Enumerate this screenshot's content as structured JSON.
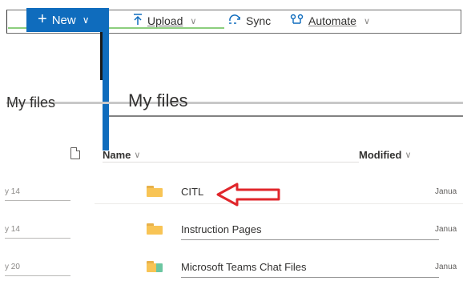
{
  "toolbar": {
    "new_label": "New",
    "upload_label": "Upload",
    "sync_label": "Sync",
    "automate_label": "Automate"
  },
  "breadcrumb": {
    "root": "My files"
  },
  "page": {
    "title": "My files"
  },
  "columns": {
    "name": "Name",
    "modified": "Modified"
  },
  "rows": [
    {
      "date": "y 14",
      "name": "CITL",
      "modified": "Janua",
      "icon": "folder-icon"
    },
    {
      "date": "y 14",
      "name": "Instruction Pages",
      "modified": "Janua",
      "icon": "folder-icon"
    },
    {
      "date": "y 20",
      "name": "Microsoft Teams Chat Files",
      "modified": "Janua",
      "icon": "teams-folder-icon"
    }
  ],
  "colors": {
    "accent": "#0f6cbd",
    "folder": "#f8c455",
    "annotation": "#e0262b"
  }
}
